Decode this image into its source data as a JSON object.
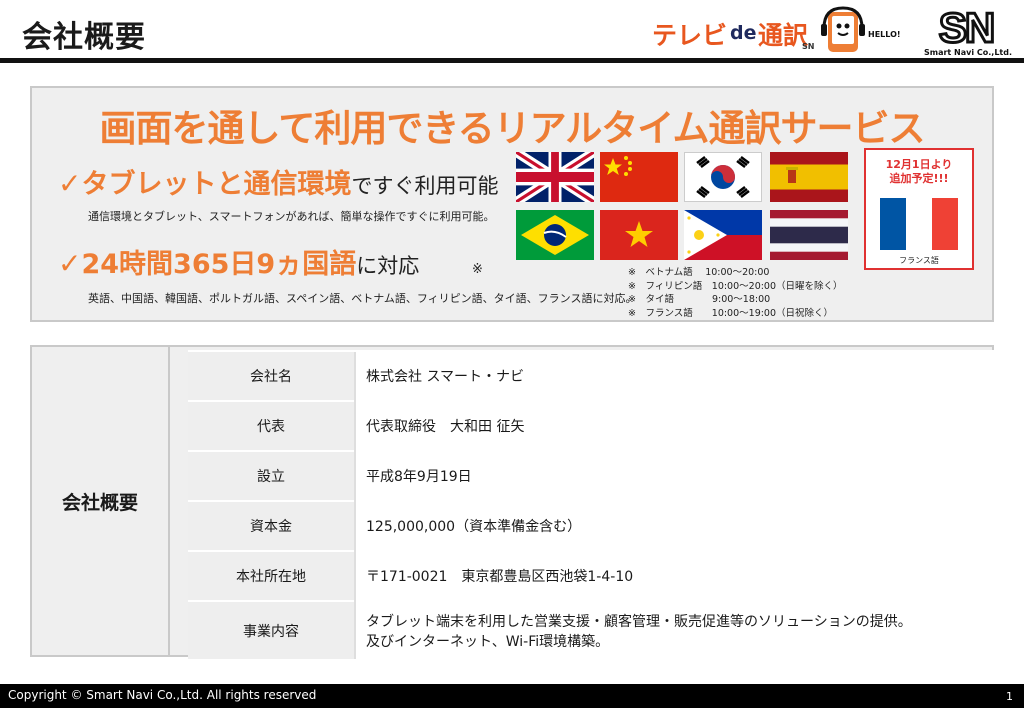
{
  "header": {
    "title": "会社概要",
    "tv_logo": {
      "part1": "テレビ",
      "part2": "de",
      "part3": "通訳",
      "badge": "SN",
      "hello": "HELLO!"
    },
    "company_logo": {
      "mark": "SN",
      "caption": "Smart Navi Co.,Ltd."
    }
  },
  "banner": {
    "headline": "画面を通して利用できるリアルタイム通訳サービス",
    "feature1": {
      "check": "✓",
      "highlight": "タブレットと通信環境",
      "tail": "ですぐ利用可能",
      "desc": "通信環境とタブレット、スマートフォンがあれば、簡単な操作ですぐに利用可能。"
    },
    "feature2": {
      "check": "✓",
      "highlight": "24時間365日9ヵ国語",
      "tail": "に対応",
      "mark": "※",
      "desc": "英語、中国語、韓国語、ポルトガル語、スペイン語、ベトナム語、フィリピン語、タイ語、フランス語に対応。"
    },
    "flags": [
      "uk-flag-icon",
      "china-flag-icon",
      "korea-flag-icon",
      "spain-flag-icon",
      "brazil-flag-icon",
      "vietnam-flag-icon",
      "philippines-flag-icon",
      "thailand-flag-icon"
    ],
    "hours": [
      "※　ベトナム語　 10:00～20:00",
      "※　フィリピン語　10:00～20:00（日曜を除く）",
      "※　タイ語　　　　9:00～18:00",
      "※　フランス語　　10:00～19:00（日祝除く）"
    ],
    "french": {
      "note_line1": "12月1日より",
      "note_line2": "追加予定!!!",
      "label": "フランス語"
    }
  },
  "profile": {
    "side_label": "会社概要",
    "rows": [
      {
        "key": "会社名",
        "value": "株式会社 スマート・ナビ"
      },
      {
        "key": "代表",
        "value": "代表取締役　大和田 征矢"
      },
      {
        "key": "設立",
        "value": "平成8年9月19日"
      },
      {
        "key": "資本金",
        "value": "125,000,000（資本準備金含む）"
      },
      {
        "key": "本社所在地",
        "value": "〒171-0021　東京都豊島区西池袋1-4-10"
      },
      {
        "key": "事業内容",
        "value": "タブレット端末を利用した営業支援・顧客管理・販売促進等のソリューションの提供。",
        "value2": "及びインターネット、Wi-Fi環境構築。"
      }
    ]
  },
  "footer": {
    "copyright": "Copyright © Smart Navi Co.,Ltd. All rights reserved",
    "page": "1"
  },
  "colors": {
    "accent": "#ee7e35",
    "alert": "#e03131",
    "dark": "#111111"
  }
}
